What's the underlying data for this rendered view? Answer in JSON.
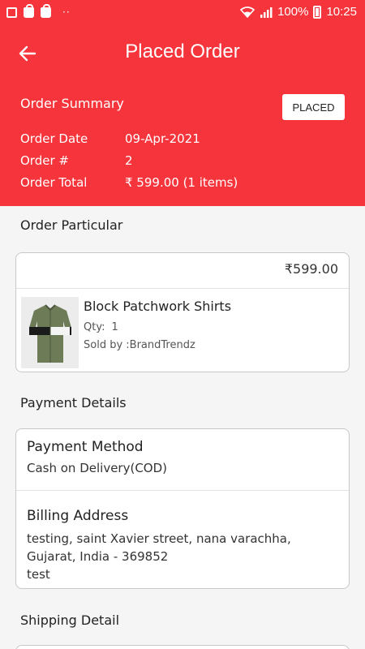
{
  "status_bar": {
    "battery": "100%",
    "time": "10:25",
    "dots": "··"
  },
  "app_bar": {
    "title": "Placed Order"
  },
  "summary": {
    "title": "Order Summary",
    "status": "PLACED",
    "order_date_label": "Order Date",
    "order_date": "09-Apr-2021",
    "order_no_label": "Order #",
    "order_no": "2",
    "order_total_label": "Order Total",
    "order_total": "₹ 599.00 (1 items)"
  },
  "particular": {
    "title": "Order Particular",
    "price": "₹599.00",
    "product_name": "Block Patchwork Shirts",
    "qty_label": "Qty:",
    "qty": "1",
    "sold_by": "Sold by :BrandTrendz"
  },
  "payment": {
    "title": "Payment Details",
    "method_label": "Payment Method",
    "method": "Cash on Delivery(COD)",
    "billing_label": "Billing Address",
    "billing_line1": "testing, saint Xavier  street, nana varachha,",
    "billing_line2": "Gujarat, India - 369852",
    "billing_line3": "test"
  },
  "shipping": {
    "title": "Shipping Detail"
  },
  "colors": {
    "header_red": "#f5343b",
    "background": "#f5f5f5"
  },
  "icons": [
    "image-icon",
    "shopping-bag-icon",
    "wifi-icon",
    "signal-icon",
    "battery-icon",
    "back-arrow-icon"
  ]
}
